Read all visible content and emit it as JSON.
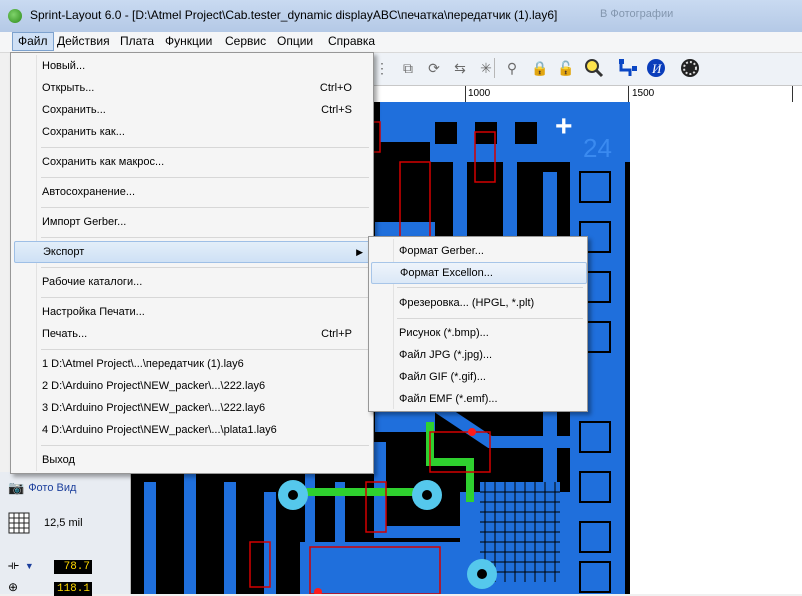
{
  "window": {
    "title": "Sprint-Layout 6.0 - [D:\\Atmel Project\\Cab.tester_dynamic displayABC\\печатка\\передатчик (1).lay6]",
    "ghost_text": "В Фотографии"
  },
  "menubar": [
    {
      "label": "Файл"
    },
    {
      "label": "Действия"
    },
    {
      "label": "Плата"
    },
    {
      "label": "Функции"
    },
    {
      "label": "Сервис"
    },
    {
      "label": "Опции"
    },
    {
      "label": "Справка"
    }
  ],
  "ruler": {
    "ticks": [
      "1000",
      "1500"
    ]
  },
  "file_menu": {
    "new": {
      "label": "Новый..."
    },
    "open": {
      "label": "Открыть...",
      "shortcut": "Ctrl+O"
    },
    "save": {
      "label": "Сохранить...",
      "shortcut": "Ctrl+S"
    },
    "save_as": {
      "label": "Сохранить как..."
    },
    "save_macro": {
      "label": "Сохранить как макрос..."
    },
    "autosave": {
      "label": "Автосохранение..."
    },
    "import_gerber": {
      "label": "Импорт Gerber..."
    },
    "export": {
      "label": "Экспорт",
      "arrow": "▶"
    },
    "work_dirs": {
      "label": "Рабочие каталоги..."
    },
    "print_setup": {
      "label": "Настройка Печати..."
    },
    "print": {
      "label": "Печать...",
      "shortcut": "Ctrl+P"
    },
    "recent": [
      "1 D:\\Atmel Project\\...\\передатчик (1).lay6",
      "2 D:\\Arduino Project\\NEW_packer\\...\\222.lay6",
      "3 D:\\Arduino Project\\NEW_packer\\...\\222.lay6",
      "4 D:\\Arduino Project\\NEW_packer\\...\\plata1.lay6"
    ],
    "exit": {
      "label": "Выход"
    }
  },
  "export_menu": {
    "gerber": "Формат Gerber...",
    "excellon": "Формат Excellon...",
    "milling": "Фрезеровка... (HPGL, *.plt)",
    "bmp": "Рисунок (*.bmp)...",
    "jpg": "Файл JPG (*.jpg)...",
    "gif": "Файл GIF (*.gif)...",
    "emf": "Файл EMF (*.emf)..."
  },
  "left_panel": {
    "photo_view": "Фото Вид",
    "grid": "12,5 mil",
    "value1": "78.7",
    "value2": "118.1"
  },
  "board": {
    "label": "24",
    "plus": "+"
  },
  "colors": {
    "copper": "#1f6fdc",
    "silk": "#d40000",
    "bg": "#000000",
    "hole": "#55c8ec",
    "green": "#2fd12f"
  }
}
